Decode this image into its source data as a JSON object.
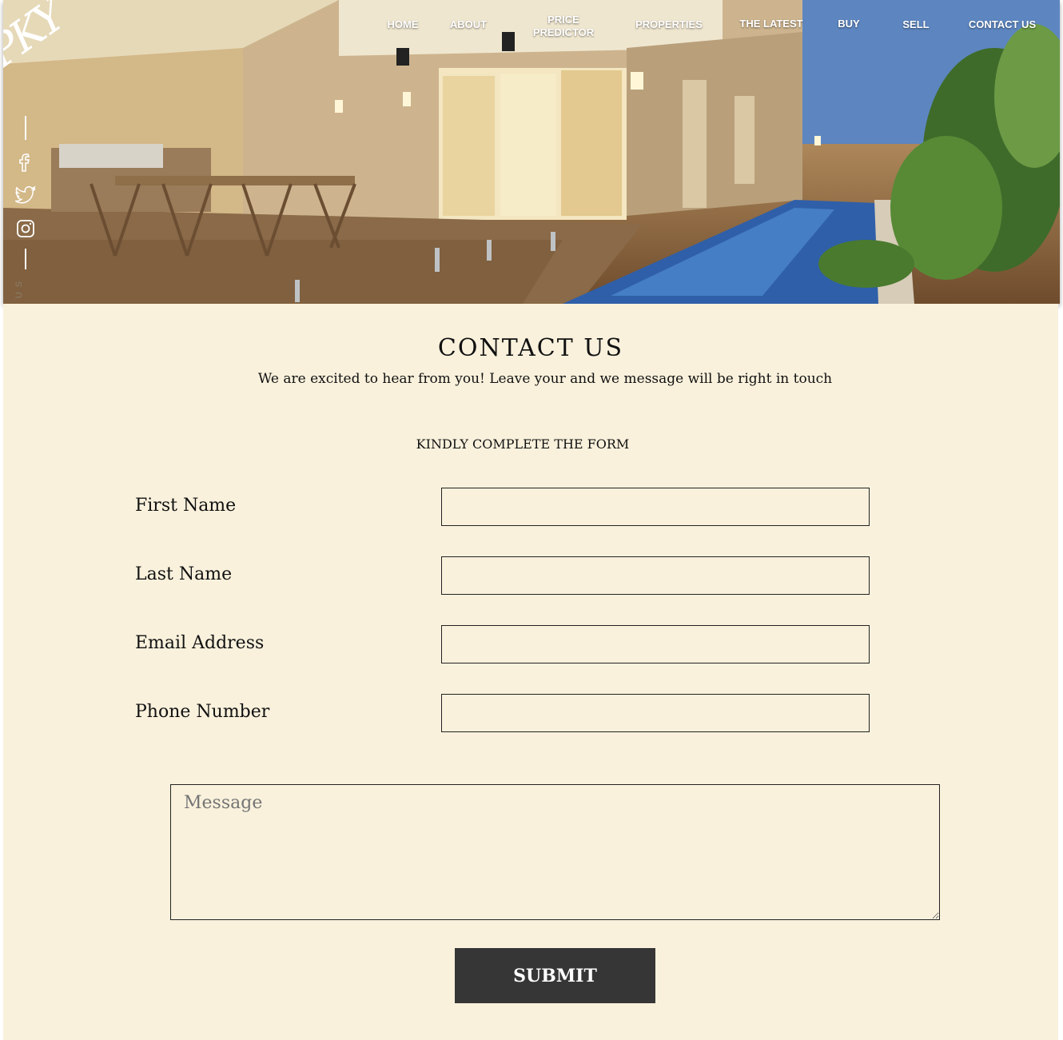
{
  "brand": {
    "logo_text": "PKY"
  },
  "nav": {
    "items": [
      {
        "label": "HOME"
      },
      {
        "label": "ABOUT"
      },
      {
        "label": "PRICE\nPREDICTOR"
      },
      {
        "label": "PROPERTIES"
      },
      {
        "label": "THE LATEST"
      },
      {
        "label": "BUY"
      },
      {
        "label": "SELL"
      },
      {
        "label": "CONTACT US"
      }
    ]
  },
  "social": {
    "icons": [
      "facebook-icon",
      "twitter-icon",
      "instagram-icon"
    ],
    "follow_text": "FOLLOW US"
  },
  "contact": {
    "title": "CONTACT US",
    "subtitle": "We are excited to hear from you! Leave your and we message will be right in touch",
    "form_heading": "KINDLY COMPLETE THE FORM",
    "fields": [
      {
        "label": "First Name",
        "value": ""
      },
      {
        "label": "Last Name",
        "value": ""
      },
      {
        "label": "Email Address",
        "value": ""
      },
      {
        "label": "Phone Number",
        "value": ""
      }
    ],
    "message_placeholder": "Message",
    "submit_label": "SUBMIT"
  },
  "colors": {
    "content_bg": "#f9f1dc",
    "submit_bg": "#363636",
    "text": "#111111"
  }
}
